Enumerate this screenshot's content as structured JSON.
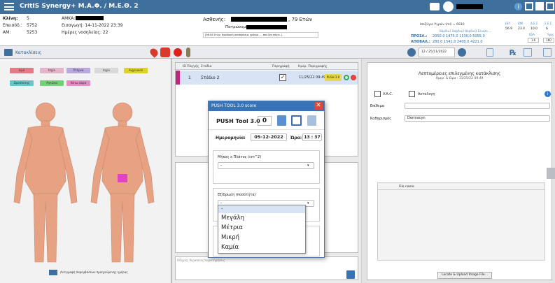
{
  "app": {
    "title": "CritIS Synergy+   M.A.Φ. / M.E.Θ. 2"
  },
  "patient": {
    "bed_label": "Κλίνη:",
    "bed": "5",
    "amka_label": "ΑΜΚΑ:",
    "admission_label": "Επεισόδ.:",
    "admission": "5752",
    "entry_label": "Εισαγωγή: 14-11-2022 23:39",
    "am_label": "ΑΜ:",
    "am": "5253",
    "days_label": "Ημέρες νοσηλείας: 22",
    "patient_label": "Ασθενής:",
    "age": ", 79 Ετών",
    "father_label": "Πατρώνυμο:",
    "note": "[96.00 Ετών. Καρδιακή ανεπάρκεια, χρόνια ..., που δεν πάγει..]"
  },
  "vitals": {
    "header": "Ισοζύγιο Υγρών (ml) = 6910",
    "row1": "Βάρδια1  Βάρδια2  Βάρδια3  Σύνολο ...",
    "input_label": "ΠΡΟΣΛ.:",
    "input_values": "2050.0   1475.0   1530.0   5055.0",
    "output_label": "ΑΠΟΒΑΛ.:",
    "output_values": "280.0   1541.0   2400.0   4221.0",
    "col_headers": [
      "ΕΕΥ",
      "ΒΜΙ",
      "Δ.Ε.Σ.",
      "Σ.Ε.Σ."
    ],
    "col_values": [
      "56.9",
      "23.4",
      "10.0",
      "6"
    ],
    "bsa_label": "BSA",
    "bsa": "1.6",
    "height_label": "Ύψος",
    "height": "160",
    "date": "12 / 25/11/2022"
  },
  "section": {
    "label": "Κατακλίσεις"
  },
  "zones": [
    "Ιερό",
    "Ισχίο",
    "Πτέρνα",
    "Ισχίο",
    "Αυχενικού",
    "Ωμοπλάτης",
    "Αγκώνα",
    "Κάτω άκρα"
  ],
  "body_note": "Αντιγραφή παρεμβάσεων προηγούμενης ημέρας",
  "table": {
    "headers": [
      "ID Πληγής",
      "Στάδιο",
      "Περιγραφή",
      "Ημερ. Περιγραφής"
    ],
    "row": {
      "id": "1",
      "stage": "Στάδιο 2",
      "date": "11/25/22 09:49",
      "tool": "PUSH 3.0"
    }
  },
  "observations_placeholder": "Οδηγίες θεραπείας/παρατηρήσεις",
  "right": {
    "title": "Λεπτομέρειες επιλεγμένης κατάκλισης",
    "date": "Ημερ. & Ώρα : 11/25/22 09:49",
    "vac": "V.A.C.",
    "autologous": "Αυτόλογη",
    "dressing_label": "Επίθεμα",
    "cleaning_label": "Καθαρισμός",
    "cleaning": "Dermacyn",
    "file_header": "File name",
    "upload": "Locate & Upload Image File..."
  },
  "dialog": {
    "title": "PUSH TOOL 3.0 score",
    "tool_label": "PUSH Tool 3.0",
    "score": "0",
    "date_label": "Ημερομηνία:",
    "date": "05-12-2022",
    "time_label": "Ώρα:",
    "hour": "13",
    "minute": "37",
    "length_label": "Μήκος x Πλάτος (cm^2)",
    "length_value": "-",
    "exudate_label": "Εξίδρωση (ποσότητα)",
    "exudate_value": "-",
    "options": [
      "-",
      "Μεγάλη",
      "Μέτρια",
      "Μικρή",
      "Καμία"
    ]
  },
  "colors": {
    "topbar": "#3f6f9c",
    "dialog_header": "#3873b8",
    "highlight": "#d6e4f5"
  }
}
